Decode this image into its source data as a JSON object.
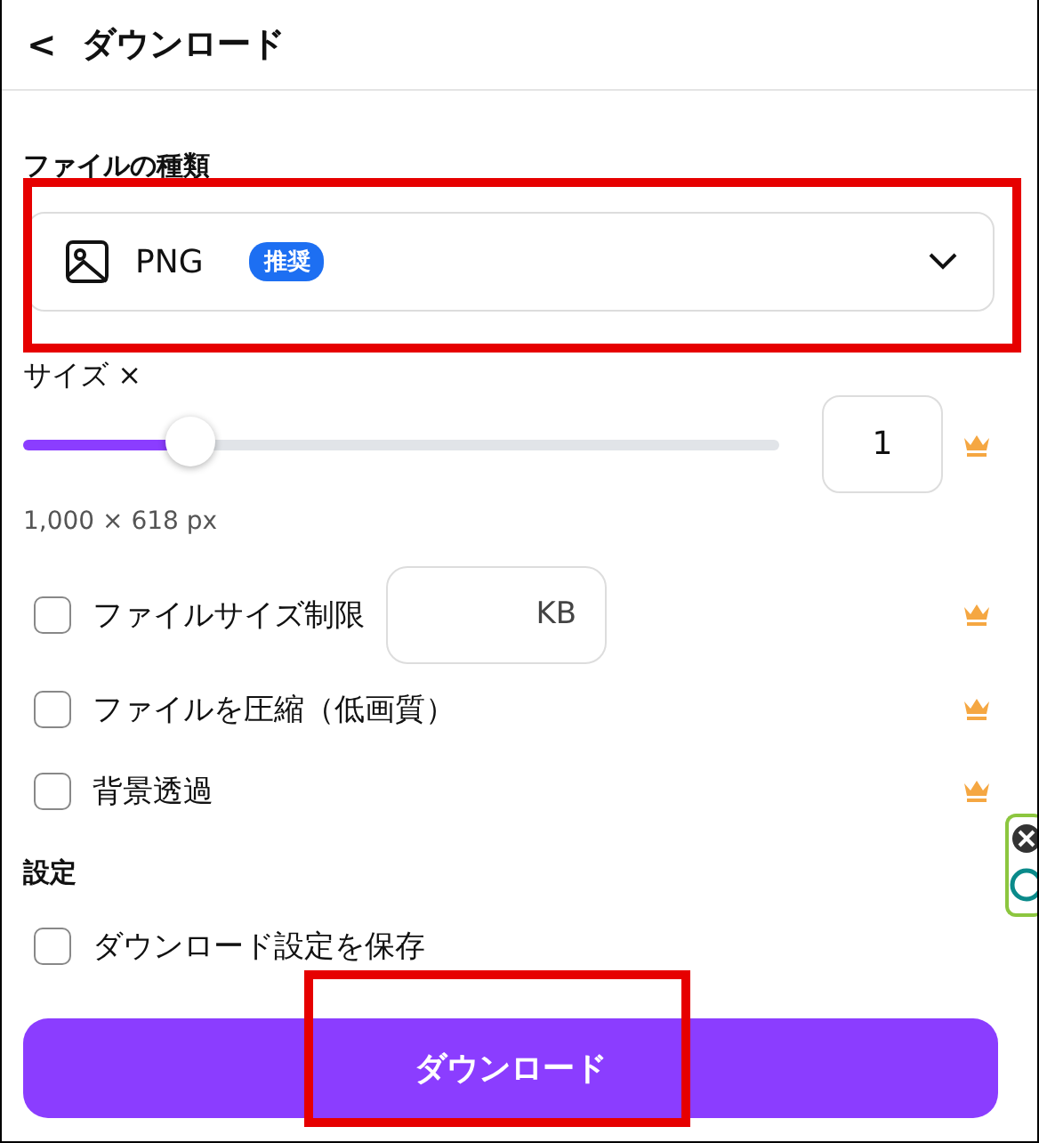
{
  "header": {
    "back": "<",
    "title": "ダウンロード"
  },
  "file_type": {
    "label": "ファイルの種類",
    "value": "PNG",
    "badge": "推奨"
  },
  "size": {
    "label": "サイズ ×",
    "level": 0.22,
    "value": "1",
    "premium": true,
    "dimensions": "1,000 × 618 px"
  },
  "options": [
    {
      "kind": "field",
      "label": "ファイルサイズ制限",
      "checked": false,
      "unit": "KB",
      "premium": true
    },
    {
      "kind": "plain",
      "label": "ファイルを圧縮（低画質）",
      "checked": false,
      "premium": true
    },
    {
      "kind": "plain",
      "label": "背景透過",
      "checked": false,
      "premium": true
    }
  ],
  "settings": {
    "label": "設定",
    "options": [
      {
        "kind": "plain",
        "label": "ダウンロード設定を保存",
        "checked": false,
        "premium": false
      }
    ]
  },
  "download_button": "ダウンロード"
}
